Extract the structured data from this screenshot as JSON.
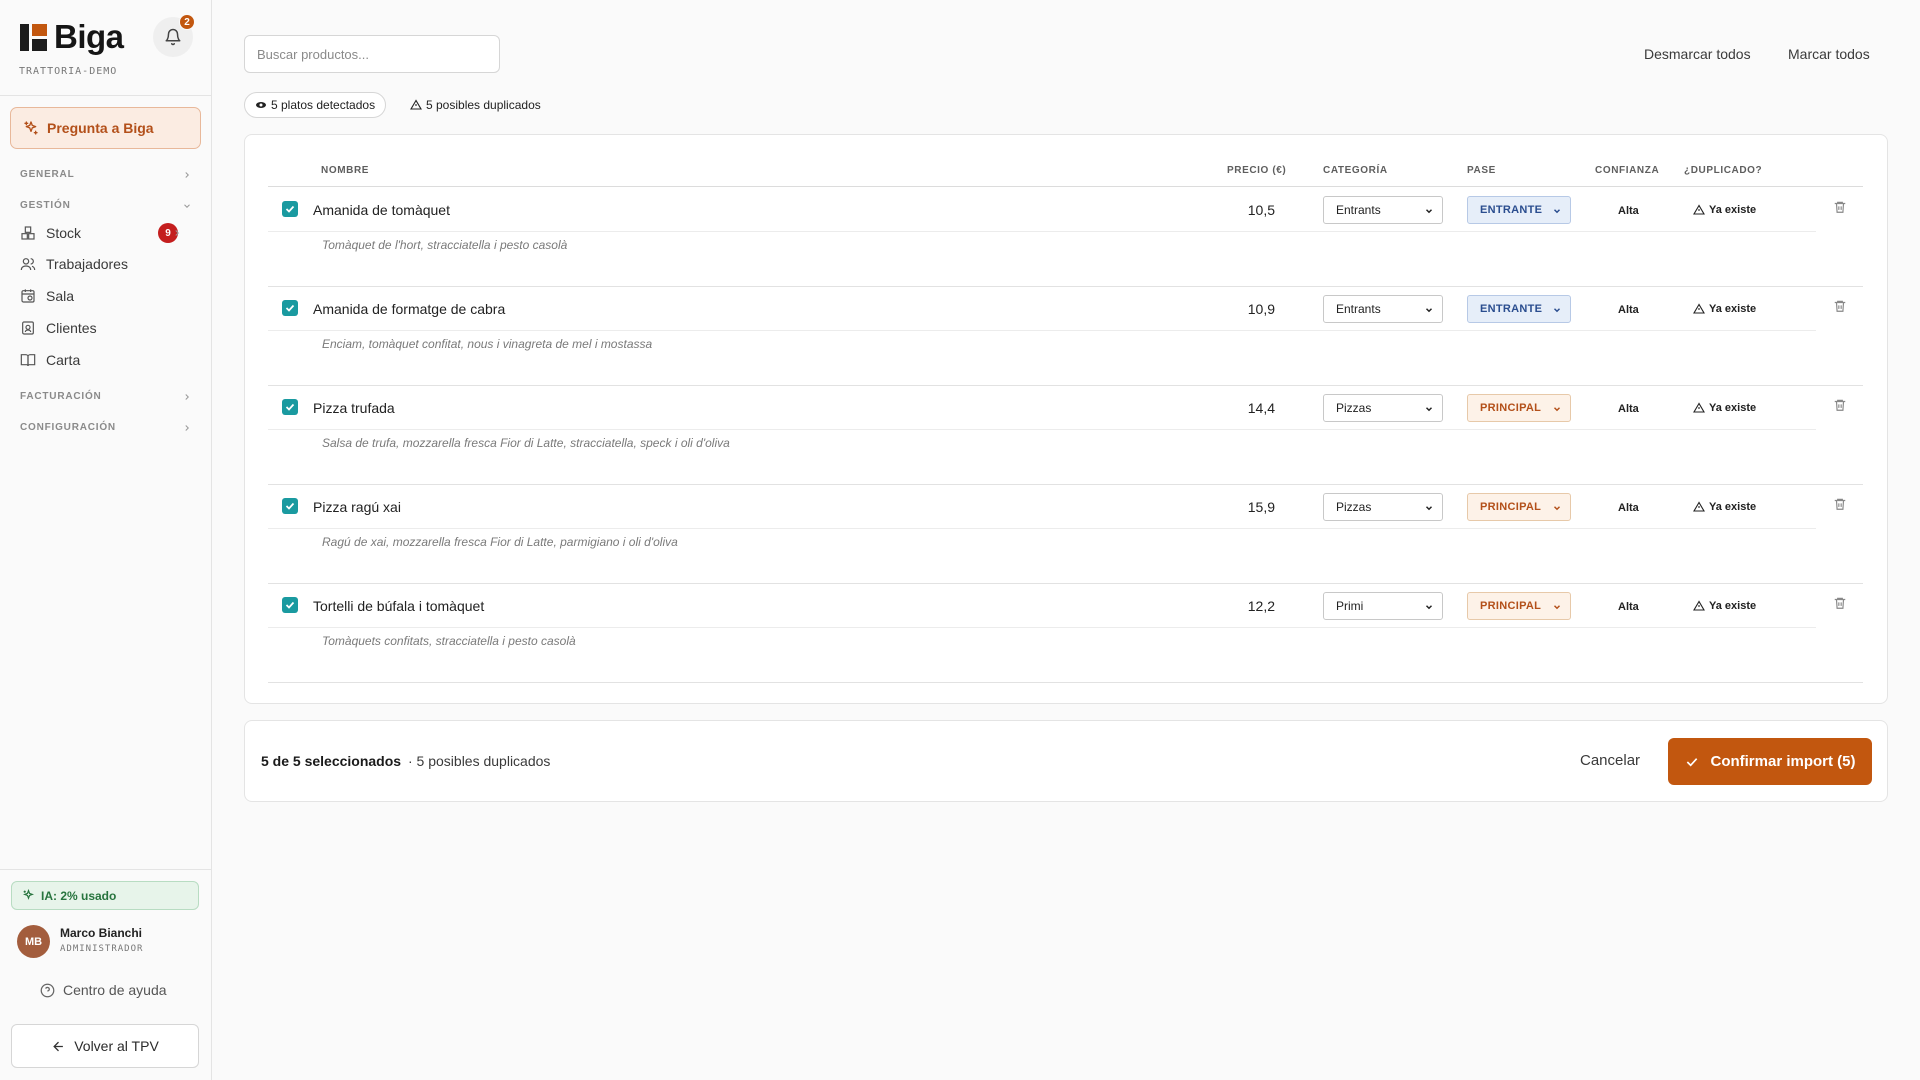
{
  "brand": {
    "name": "Biga",
    "tenant": "TRATTORIA-DEMO"
  },
  "notifications": {
    "count": "2"
  },
  "sidebar": {
    "ask_label": "Pregunta a Biga",
    "sections": {
      "general": "GENERAL",
      "gestion": "GESTIÓN",
      "facturacion": "FACTURACIÓN",
      "configuracion": "CONFIGURACIÓN"
    },
    "items": [
      {
        "label": "Stock",
        "badge": "9"
      },
      {
        "label": "Trabajadores"
      },
      {
        "label": "Sala"
      },
      {
        "label": "Clientes"
      },
      {
        "label": "Carta"
      }
    ],
    "ai_usage": "IA: 2% usado",
    "user": {
      "initials": "MB",
      "name": "Marco Bianchi",
      "role": "ADMINISTRADOR"
    },
    "help": "Centro de ayuda",
    "back": "Volver al TPV"
  },
  "toolbar": {
    "search_placeholder": "Buscar productos...",
    "unmark_all": "Desmarcar todos",
    "mark_all": "Marcar todos"
  },
  "chips": {
    "detected": "5 platos detectados",
    "duplicates": "5 posibles duplicados"
  },
  "table": {
    "headers": {
      "name": "NOMBRE",
      "price": "PRECIO (€)",
      "category": "CATEGORÍA",
      "pase": "PASE",
      "confidence": "CONFIANZA",
      "duplicate": "¿DUPLICADO?"
    },
    "rows": [
      {
        "checked": true,
        "name": "Amanida de tomàquet",
        "desc": "Tomàquet de l'hort, stracciatella i pesto casolà",
        "price": "10,5",
        "category": "Entrants",
        "pase": "ENTRANTE",
        "pase_type": "entrante",
        "confidence": "Alta",
        "duplicate": "Ya existe"
      },
      {
        "checked": true,
        "name": "Amanida de formatge de cabra",
        "desc": "Enciam, tomàquet confitat, nous i vinagreta de mel i mostassa",
        "price": "10,9",
        "category": "Entrants",
        "pase": "ENTRANTE",
        "pase_type": "entrante",
        "confidence": "Alta",
        "duplicate": "Ya existe"
      },
      {
        "checked": true,
        "name": "Pizza trufada",
        "desc": "Salsa de trufa, mozzarella fresca Fior di Latte, stracciatella, speck i oli d'oliva",
        "price": "14,4",
        "category": "Pizzas",
        "pase": "PRINCIPAL",
        "pase_type": "principal",
        "confidence": "Alta",
        "duplicate": "Ya existe"
      },
      {
        "checked": true,
        "name": "Pizza ragú xai",
        "desc": "Ragú de xai, mozzarella fresca Fior di Latte, parmigiano i oli d'oliva",
        "price": "15,9",
        "category": "Pizzas",
        "pase": "PRINCIPAL",
        "pase_type": "principal",
        "confidence": "Alta",
        "duplicate": "Ya existe"
      },
      {
        "checked": true,
        "name": "Tortelli de búfala i tomàquet",
        "desc": "Tomàquets confitats, stracciatella i pesto casolà",
        "price": "12,2",
        "category": "Primi",
        "pase": "PRINCIPAL",
        "pase_type": "principal",
        "confidence": "Alta",
        "duplicate": "Ya existe"
      }
    ]
  },
  "footer": {
    "selected": "5 de 5 seleccionados",
    "duplicates": "· 5 posibles duplicados",
    "cancel": "Cancelar",
    "confirm": "Confirmar import (5)"
  },
  "colors": {
    "accent": "#c2570f",
    "checkbox": "#1a9aa0",
    "badge_red": "#c41e1e",
    "ai_green": "#27743e",
    "pase_entrante": "#2a4d8f",
    "pase_principal": "#b3501a"
  }
}
